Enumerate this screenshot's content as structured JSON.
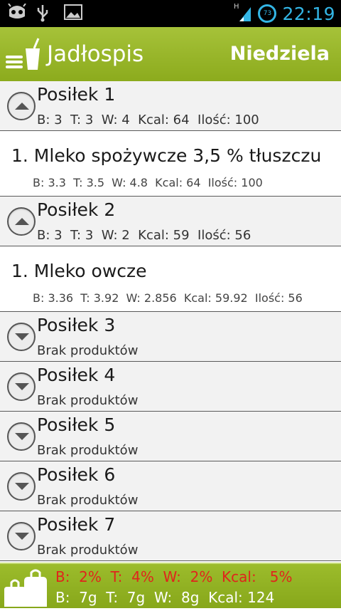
{
  "statusbar": {
    "icons": [
      "android-robot-icon",
      "usb-icon",
      "image-icon"
    ],
    "signal_label": "H",
    "battery": "73",
    "time": "22:19"
  },
  "actionbar": {
    "title": "Jadłospis",
    "day": "Niedziela"
  },
  "meals": [
    {
      "title": "Posiłek 1",
      "summary": "B: 3  T: 3  W: 4  Kcal: 64  Ilość: 100",
      "expanded": true,
      "products": [
        {
          "name": "1. Mleko spożywcze 3,5 % tłuszczu",
          "values": "B: 3.3  T: 3.5  W: 4.8  Kcal: 64  Ilość: 100"
        }
      ]
    },
    {
      "title": "Posiłek 2",
      "summary": "B: 3  T: 3  W: 2  Kcal: 59  Ilość: 56",
      "expanded": true,
      "products": [
        {
          "name": "1. Mleko owcze",
          "values": "B: 3.36  T: 3.92  W: 2.856  Kcal: 59.92  Ilość: 56"
        }
      ]
    },
    {
      "title": "Posiłek 3",
      "summary": "Brak produktów",
      "expanded": false,
      "products": []
    },
    {
      "title": "Posiłek 4",
      "summary": "Brak produktów",
      "expanded": false,
      "products": []
    },
    {
      "title": "Posiłek 5",
      "summary": "Brak produktów",
      "expanded": false,
      "products": []
    },
    {
      "title": "Posiłek 6",
      "summary": "Brak produktów",
      "expanded": false,
      "products": []
    },
    {
      "title": "Posiłek 7",
      "summary": "Brak produktów",
      "expanded": false,
      "products": []
    }
  ],
  "footer": {
    "icon": "scale-weights-icon",
    "percent_row": "B:  2%  T:  4%  W:  2%  Kcal:   5%",
    "totals_row": "B:  7g  T:  7g  W:  8g  Kcal: 124",
    "percent_color": "#e0241c"
  },
  "colors": {
    "accent": "#33b5e5",
    "bar_green": "#98b82a"
  }
}
